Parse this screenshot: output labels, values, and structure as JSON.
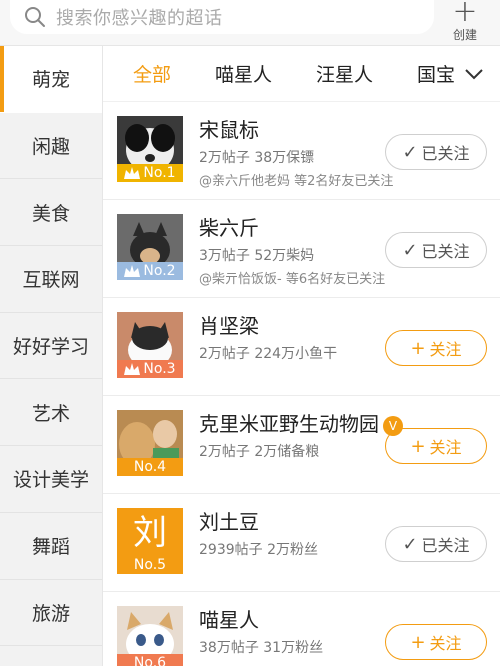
{
  "search": {
    "placeholder": "搜索你感兴趣的超话"
  },
  "create": {
    "label": "创建"
  },
  "sidebar": {
    "items": [
      {
        "label": "萌宠"
      },
      {
        "label": "闲趣"
      },
      {
        "label": "美食"
      },
      {
        "label": "互联网"
      },
      {
        "label": "好好学习"
      },
      {
        "label": "艺术"
      },
      {
        "label": "设计美学"
      },
      {
        "label": "舞蹈"
      },
      {
        "label": "旅游"
      }
    ]
  },
  "tabs": [
    {
      "label": "全部"
    },
    {
      "label": "喵星人"
    },
    {
      "label": "汪星人"
    },
    {
      "label": "国宝"
    }
  ],
  "list": [
    {
      "name": "宋鼠标",
      "stats": "2万帖子 38万保镖",
      "friends": "@亲六斤他老妈 等2名好友已关注",
      "rank": "No.1",
      "follow": "已关注"
    },
    {
      "name": "柴六斤",
      "stats": "3万帖子 52万柴妈",
      "friends": "@柴亓恰饭饭- 等6名好友已关注",
      "rank": "No.2",
      "follow": "已关注"
    },
    {
      "name": "肖坚梁",
      "stats": "2万帖子 224万小鱼干",
      "friends": "",
      "rank": "No.3",
      "follow": "关注"
    },
    {
      "name": "克里米亚野生动物园",
      "stats": "2万帖子 2万储备粮",
      "friends": "",
      "rank": "No.4",
      "follow": "关注"
    },
    {
      "name": "刘土豆",
      "stats": "2939帖子 2万粉丝",
      "friends": "",
      "rank": "No.5",
      "avatar_text": "刘",
      "follow": "已关注"
    },
    {
      "name": "喵星人",
      "stats": "38万帖子 31万粉丝",
      "friends": "",
      "rank": "No.6",
      "follow": "关注"
    }
  ],
  "colors": {
    "accent": "#f39c12",
    "gold": "#f0b400",
    "silver": "#9bbbe0",
    "bronze": "#f07a50"
  }
}
